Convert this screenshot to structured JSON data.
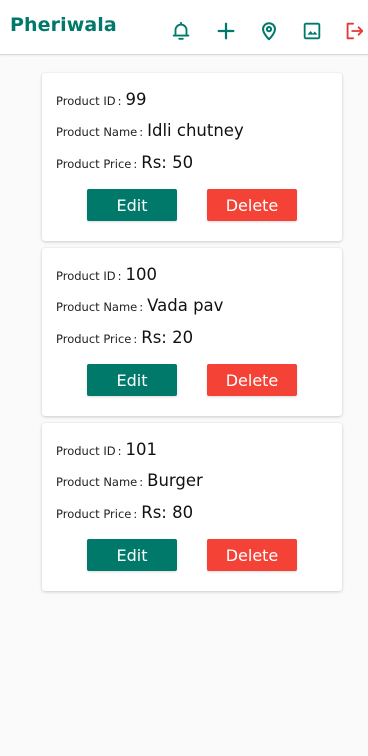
{
  "app": {
    "title": "Pheriwala"
  },
  "toolbar": {
    "icons": [
      "bell-icon",
      "plus-icon",
      "location-pin-icon",
      "image-icon",
      "logout-icon"
    ]
  },
  "colors": {
    "primary": "#00796b",
    "danger": "#f44336",
    "logout": "#e53935"
  },
  "labels": {
    "product_id": "Product ID",
    "product_name": "Product Name",
    "product_price": "Product Price",
    "separator": ":",
    "edit": "Edit",
    "delete": "Delete"
  },
  "products": [
    {
      "id": "99",
      "name": "Idli chutney",
      "price": "Rs: 50"
    },
    {
      "id": "100",
      "name": "Vada pav",
      "price": "Rs: 20"
    },
    {
      "id": "101",
      "name": "Burger",
      "price": "Rs: 80"
    }
  ]
}
